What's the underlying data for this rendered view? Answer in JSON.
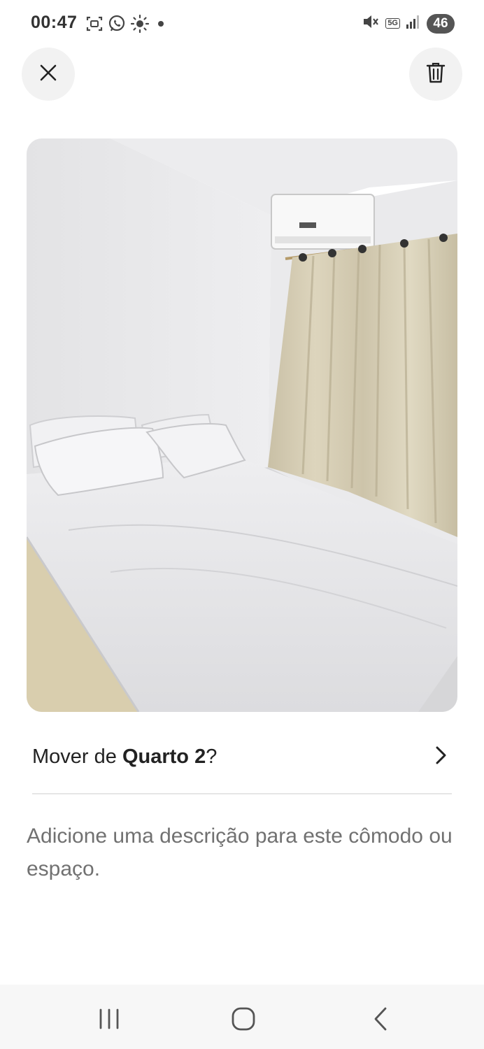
{
  "status_bar": {
    "time": "00:47",
    "battery": "46",
    "network": "5G"
  },
  "header": {
    "close_icon": "close-icon",
    "delete_icon": "trash-icon"
  },
  "photo": {
    "icon": "bedroom-photo"
  },
  "move_row": {
    "prefix": "Mover de ",
    "room_name": "Quarto 2",
    "suffix": "?"
  },
  "description": {
    "placeholder": "Adicione uma descrição para este cômodo ou espaço."
  },
  "colors": {
    "text_primary": "#222222",
    "text_secondary": "#717171",
    "button_bg": "#f2f2f2",
    "divider": "#e6e6e6"
  }
}
